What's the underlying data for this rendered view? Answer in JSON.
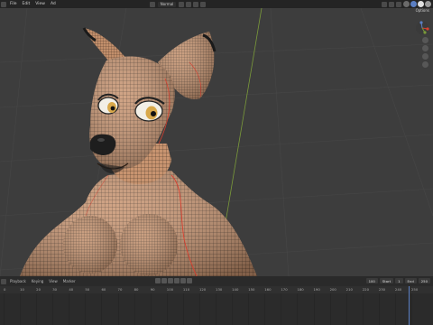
{
  "menubar": {
    "items": [
      "File",
      "Edit",
      "View",
      "Ad"
    ],
    "mode_label": "Normal"
  },
  "viewport": {
    "options_label": "Options"
  },
  "timeline": {
    "menu": [
      "Playback",
      "Keying",
      "View",
      "Marker"
    ],
    "start_label": "Start",
    "start_value": "1",
    "end_label": "End",
    "end_value": "250",
    "current_frame": "100",
    "ruler_ticks": [
      "0",
      "10",
      "20",
      "30",
      "40",
      "50",
      "60",
      "70",
      "80",
      "90",
      "100",
      "110",
      "120",
      "130",
      "140",
      "150",
      "160",
      "170",
      "180",
      "190",
      "200",
      "210",
      "220",
      "230",
      "240",
      "250"
    ]
  },
  "colors": {
    "accent_blue": "#5b7fc3",
    "skin": "#c89470",
    "wire_dark": "#3a2a1e",
    "wire_red": "#d84030"
  }
}
